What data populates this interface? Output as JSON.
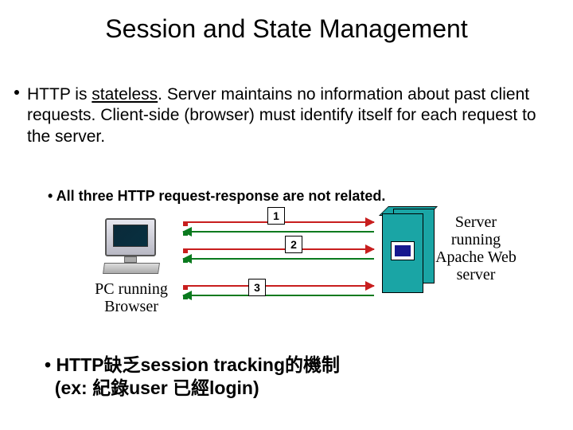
{
  "title": "Session and State Management",
  "bullet1_pre": "HTTP is ",
  "bullet1_u": "stateless",
  "bullet1_post": ". Server maintains no information about past client requests. Client-side (browser) must identify itself for each request to the server.",
  "bullet2": "• All three HTTP request-response are not related.",
  "num1": "1",
  "num2": "2",
  "num3": "3",
  "pc_label_l1": "PC running",
  "pc_label_l2": "Browser",
  "sv_label_l1": "Server",
  "sv_label_l2": "running",
  "sv_label_l3": "Apache Web",
  "sv_label_l4": "server",
  "bullet3_l1": "• HTTP缺乏session tracking的機制",
  "bullet3_l2": "  (ex: 紀錄user 已經login)"
}
